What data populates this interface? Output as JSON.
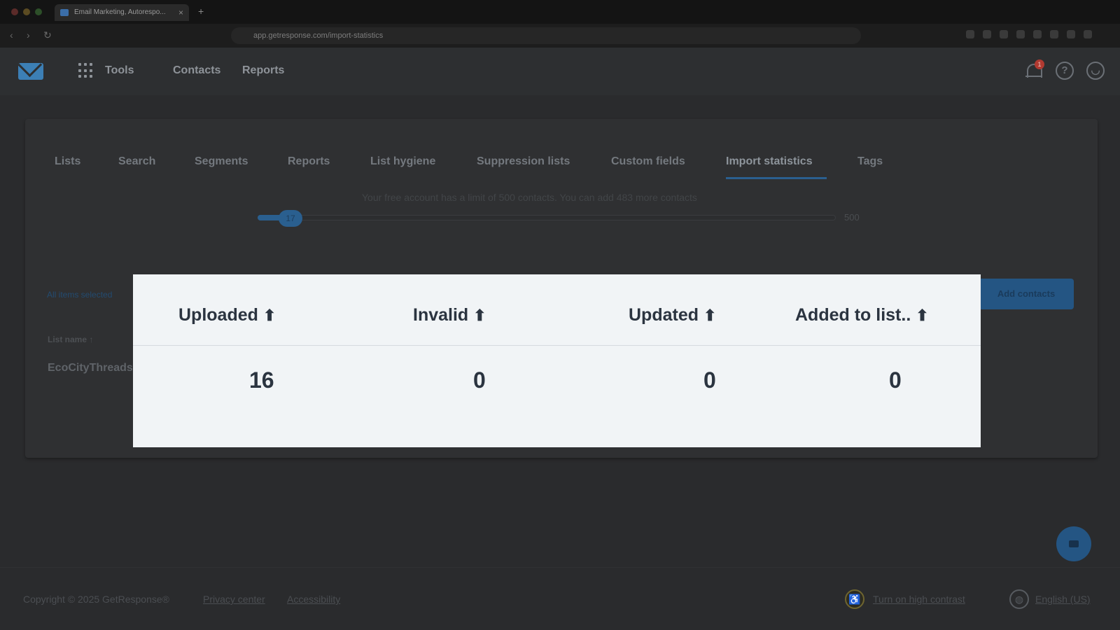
{
  "browser": {
    "tab_title": "Email Marketing, Autorespo...",
    "url": "app.getresponse.com/import-statistics",
    "tab_close": "×",
    "new_tab": "+",
    "back": "‹",
    "forward": "›",
    "reload": "↻"
  },
  "header": {
    "tools_label": "Tools",
    "contacts_label": "Contacts",
    "reports_label": "Reports",
    "notifications_count": "1",
    "help_glyph": "?",
    "account_glyph": "◡"
  },
  "tabs": [
    {
      "label": "Lists"
    },
    {
      "label": "Search"
    },
    {
      "label": "Segments"
    },
    {
      "label": "Reports"
    },
    {
      "label": "List hygiene"
    },
    {
      "label": "Suppression lists"
    },
    {
      "label": "Custom fields"
    },
    {
      "label": "Import statistics",
      "active": true
    },
    {
      "label": "Tags"
    }
  ],
  "limit": {
    "text": "Your free account has a limit of 500 contacts. You can add 483 more contacts",
    "current": "17",
    "max": "500",
    "fraction_used": 0.034
  },
  "table_bg": {
    "selection_text": "All items selected",
    "add_contacts_label": "Add contacts",
    "list_name_header": "List name ↑",
    "list_name_value": "EcoCityThreads"
  },
  "modal": {
    "columns": [
      {
        "header": "Uploaded",
        "value": "16"
      },
      {
        "header": "Invalid",
        "value": "0"
      },
      {
        "header": "Updated",
        "value": "0"
      },
      {
        "header": "Added to list..",
        "value": "0"
      }
    ],
    "sort_arrow": "⬆"
  },
  "footer": {
    "copyright": "Copyright © 2025 GetResponse®",
    "privacy": "Privacy center",
    "accessibility": "Accessibility",
    "high_contrast": "Turn on high contrast",
    "language": "English (US)",
    "access_glyph": "♿",
    "globe_glyph": "◍"
  },
  "colors": {
    "modal_bg": "#f1f4f6",
    "modal_text": "#2b3440",
    "accent": "#2a5f8f"
  }
}
